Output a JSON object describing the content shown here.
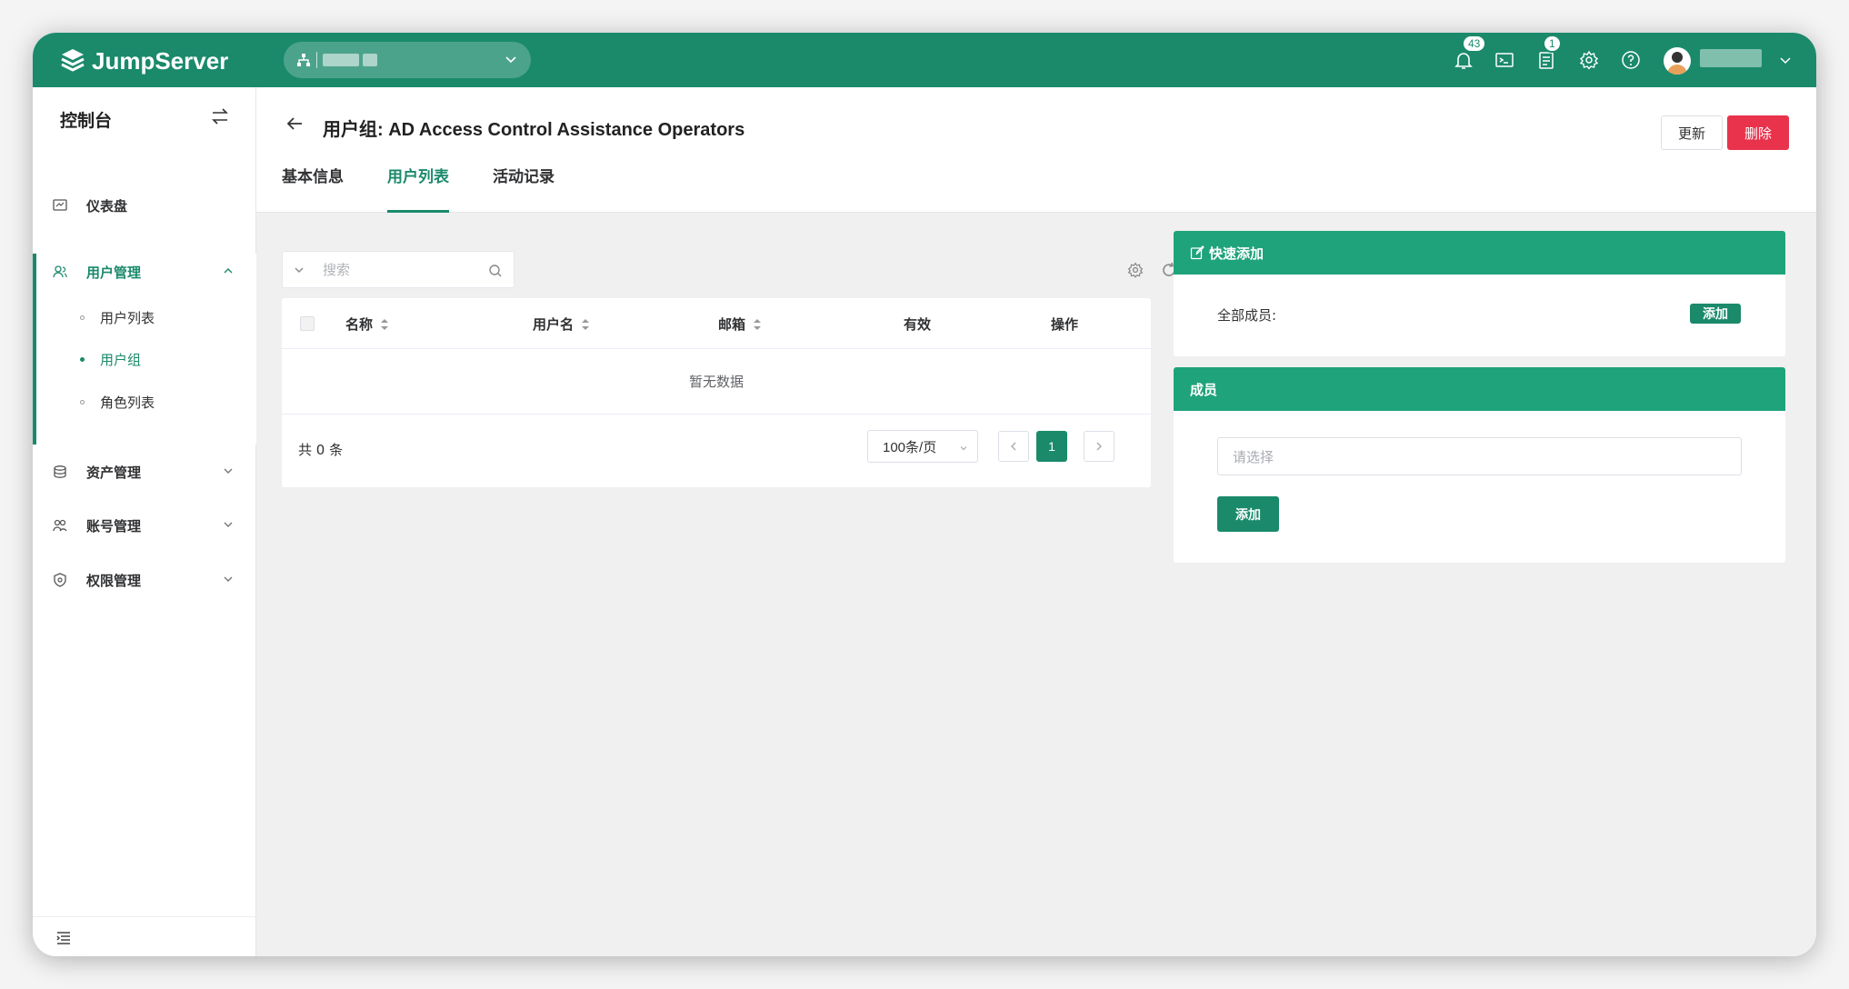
{
  "brand": {
    "name": "JumpServer",
    "primary": "#1a8a6b",
    "header_green": "#1fa37a",
    "danger": "#e9334c"
  },
  "topbar": {
    "org_icon": "sitemap-icon",
    "notifications_count": "43",
    "tickets_count": "1"
  },
  "sidebar": {
    "title": "控制台",
    "items": [
      {
        "label": "仪表盘",
        "icon": "dashboard-icon"
      },
      {
        "label": "用户管理",
        "icon": "users-icon",
        "expanded": true,
        "children": [
          {
            "label": "用户列表"
          },
          {
            "label": "用户组",
            "active": true
          },
          {
            "label": "角色列表"
          }
        ]
      },
      {
        "label": "资产管理",
        "icon": "assets-icon"
      },
      {
        "label": "账号管理",
        "icon": "accounts-icon"
      },
      {
        "label": "权限管理",
        "icon": "shield-icon"
      }
    ]
  },
  "page": {
    "title": "用户组: AD Access Control Assistance Operators",
    "update_label": "更新",
    "delete_label": "删除",
    "tabs": [
      {
        "label": "基本信息"
      },
      {
        "label": "用户列表",
        "active": true
      },
      {
        "label": "活动记录"
      }
    ]
  },
  "table": {
    "search_placeholder": "搜索",
    "columns": [
      "名称",
      "用户名",
      "邮箱",
      "有效",
      "操作"
    ],
    "empty_text": "暂无数据",
    "total_label": "共 0 条",
    "page_size": "100条/页",
    "current_page": "1"
  },
  "quick_add": {
    "title": "快速添加",
    "all_members_label": "全部成员:",
    "add_label": "添加"
  },
  "members": {
    "title": "成员",
    "select_placeholder": "请选择",
    "add_label": "添加"
  }
}
